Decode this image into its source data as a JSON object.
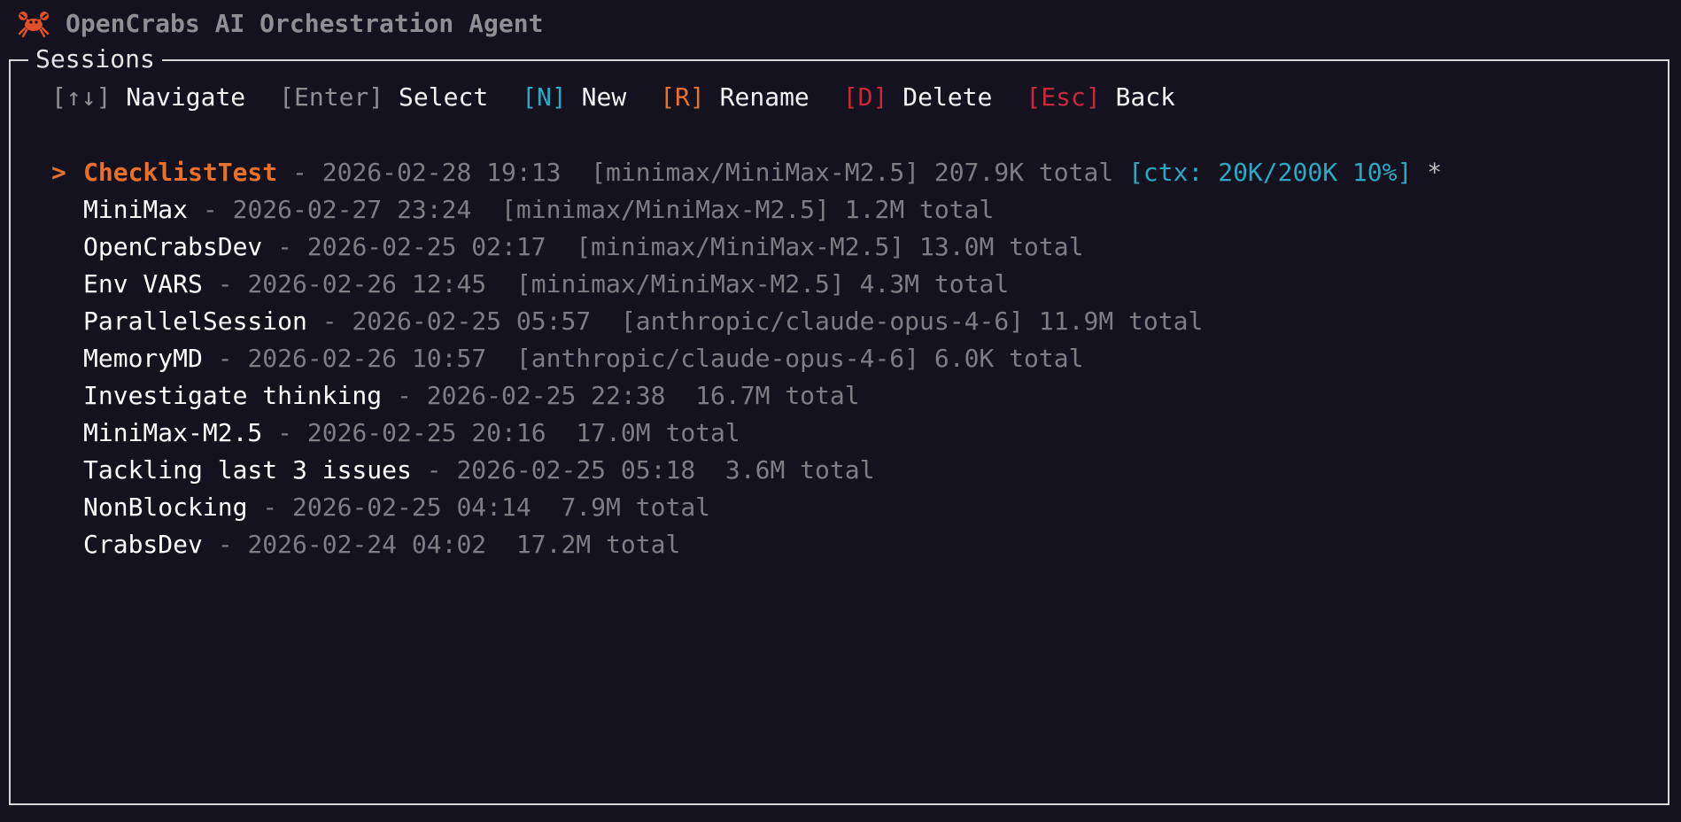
{
  "app": {
    "title": "OpenCrabs AI Orchestration Agent",
    "icon": "crab-icon"
  },
  "panel": {
    "title": "Sessions"
  },
  "help": [
    {
      "key": "[↑↓]",
      "label": "Navigate",
      "color": "#8e8e93"
    },
    {
      "key": "[Enter]",
      "label": "Select",
      "color": "#8e8e93"
    },
    {
      "key": "[N]",
      "label": "New",
      "color": "#2ca8c2"
    },
    {
      "key": "[R]",
      "label": "Rename",
      "color": "#e8702a"
    },
    {
      "key": "[D]",
      "label": "Delete",
      "color": "#c8283a"
    },
    {
      "key": "[Esc]",
      "label": "Back",
      "color": "#c8283a"
    }
  ],
  "sessions": [
    {
      "cursor": "> ",
      "name": "ChecklistTest",
      "sep": " - ",
      "datetime": "2026-02-28 19:13",
      "model": "[minimax/MiniMax-M2.5]",
      "tokens": "207.9K total",
      "ctx": "[ctx: 20K/200K 10%]",
      "star": "*",
      "selected": true
    },
    {
      "cursor": "",
      "name": "MiniMax",
      "sep": " - ",
      "datetime": "2026-02-27 23:24",
      "model": "[minimax/MiniMax-M2.5]",
      "tokens": "1.2M total",
      "ctx": "",
      "star": "",
      "selected": false
    },
    {
      "cursor": "",
      "name": "OpenCrabsDev",
      "sep": " - ",
      "datetime": "2026-02-25 02:17",
      "model": "[minimax/MiniMax-M2.5]",
      "tokens": "13.0M total",
      "ctx": "",
      "star": "",
      "selected": false
    },
    {
      "cursor": "",
      "name": "Env VARS",
      "sep": " - ",
      "datetime": "2026-02-26 12:45",
      "model": "[minimax/MiniMax-M2.5]",
      "tokens": "4.3M total",
      "ctx": "",
      "star": "",
      "selected": false
    },
    {
      "cursor": "",
      "name": "ParallelSession",
      "sep": " - ",
      "datetime": "2026-02-25 05:57",
      "model": "[anthropic/claude-opus-4-6]",
      "tokens": "11.9M total",
      "ctx": "",
      "star": "",
      "selected": false
    },
    {
      "cursor": "",
      "name": "MemoryMD",
      "sep": " - ",
      "datetime": "2026-02-26 10:57",
      "model": "[anthropic/claude-opus-4-6]",
      "tokens": "6.0K total",
      "ctx": "",
      "star": "",
      "selected": false
    },
    {
      "cursor": "",
      "name": "Investigate thinking",
      "sep": " - ",
      "datetime": "2026-02-25 22:38",
      "model": "",
      "tokens": "16.7M total",
      "ctx": "",
      "star": "",
      "selected": false
    },
    {
      "cursor": "",
      "name": "MiniMax-M2.5",
      "sep": " - ",
      "datetime": "2026-02-25 20:16",
      "model": "",
      "tokens": "17.0M total",
      "ctx": "",
      "star": "",
      "selected": false
    },
    {
      "cursor": "",
      "name": "Tackling last 3 issues",
      "sep": " - ",
      "datetime": "2026-02-25 05:18",
      "model": "",
      "tokens": "3.6M total",
      "ctx": "",
      "star": "",
      "selected": false
    },
    {
      "cursor": "",
      "name": "NonBlocking",
      "sep": " - ",
      "datetime": "2026-02-25 04:14",
      "model": "",
      "tokens": "7.9M total",
      "ctx": "",
      "star": "",
      "selected": false
    },
    {
      "cursor": "",
      "name": "CrabsDev",
      "sep": " - ",
      "datetime": "2026-02-24 04:02",
      "model": "",
      "tokens": "17.2M total",
      "ctx": "",
      "star": "",
      "selected": false
    }
  ]
}
